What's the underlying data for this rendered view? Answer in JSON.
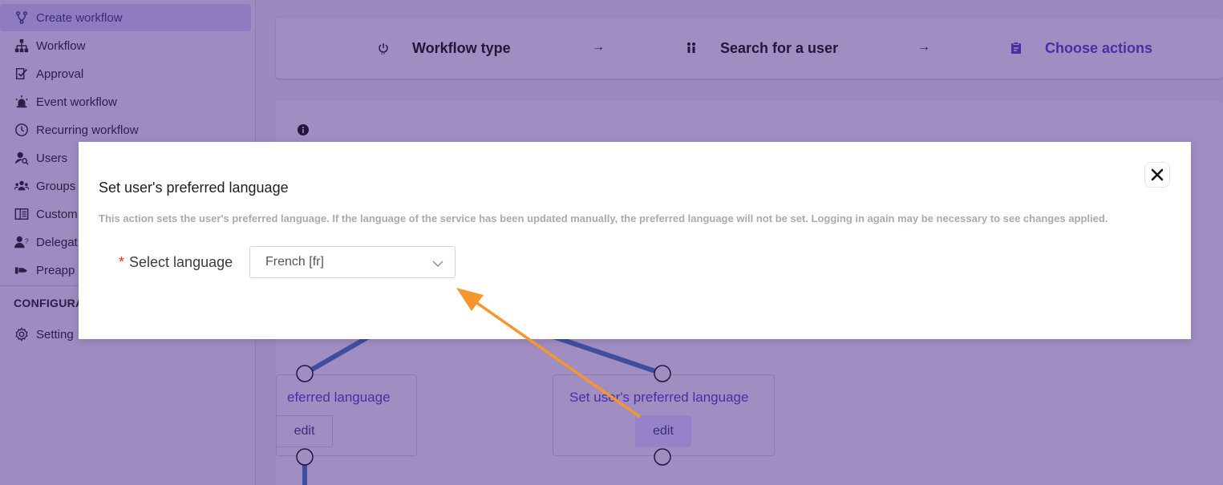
{
  "sidebar": {
    "items": [
      {
        "label": "Create workflow",
        "icon": "branch-icon"
      },
      {
        "label": "Workflow",
        "icon": "sitemap-icon"
      },
      {
        "label": "Approval",
        "icon": "approval-icon"
      },
      {
        "label": "Event workflow",
        "icon": "alarm-icon"
      },
      {
        "label": "Recurring workflow",
        "icon": "clock-icon"
      },
      {
        "label": "Users",
        "icon": "user-search-icon"
      },
      {
        "label": "Groups",
        "icon": "groups-icon"
      },
      {
        "label": "Custom",
        "icon": "columns-icon"
      },
      {
        "label": "Delegat",
        "icon": "delegate-icon"
      },
      {
        "label": "Preapp",
        "icon": "preapproval-icon"
      }
    ],
    "section_title": "CONFIGURA",
    "settings_label": "Setting"
  },
  "stepper": {
    "steps": [
      {
        "label": "Workflow type",
        "icon": "power-icon"
      },
      {
        "label": "Search for a user",
        "icon": "people-icon"
      },
      {
        "label": "Choose actions",
        "icon": "clipboard-icon"
      }
    ],
    "arrow": "→"
  },
  "canvas": {
    "node_left_title": "eferred language",
    "node_left_edit": "edit",
    "node_right_title": "Set user's preferred language",
    "node_right_edit": "edit"
  },
  "modal": {
    "title": "Set user's preferred language",
    "description": "This action sets the user's preferred language. If the language of the service has been updated manually, the preferred language will not be set. Logging in again may be necessary to see changes applied.",
    "required_mark": "*",
    "field_label": "Select language",
    "selected_value": "French [fr]"
  },
  "colors": {
    "overlay": "#9c89bf",
    "accent": "#4a2ea5",
    "annotation_arrow": "#f7962f"
  }
}
